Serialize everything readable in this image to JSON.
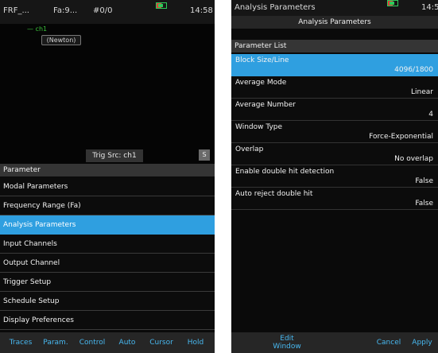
{
  "left": {
    "status": {
      "title": "FRF_...",
      "fa": "Fa:9...",
      "count": "#0/0",
      "time": "14:58"
    },
    "plot": {
      "legend": "ch1",
      "unit": "(Newton)",
      "trig_src": "Trig Src: ch1",
      "s_label": "S"
    },
    "panel_header": "Parameter",
    "menu": [
      "Modal Parameters",
      "Frequency Range (Fa)",
      "Analysis Parameters",
      "Input Channels",
      "Output Channel",
      "Trigger Setup",
      "Schedule Setup",
      "Display Preferences"
    ],
    "selected_index": 2,
    "softkeys": [
      "Traces",
      "Param.",
      "Control",
      "Auto",
      "Cursor",
      "Hold"
    ]
  },
  "right": {
    "status": {
      "title": "Analysis Parameters",
      "time": "14:5"
    },
    "dialog_title": "Analysis Parameters",
    "list_header": "Parameter List",
    "params": [
      {
        "label": "Block Size/Line",
        "value": "4096/1800"
      },
      {
        "label": "Average Mode",
        "value": "Linear"
      },
      {
        "label": "Average Number",
        "value": "4"
      },
      {
        "label": "Window Type",
        "value": "Force-Exponential"
      },
      {
        "label": "Overlap",
        "value": "No overlap"
      },
      {
        "label": "Enable double hit detection",
        "value": "False"
      },
      {
        "label": "Auto reject double hit",
        "value": "False"
      }
    ],
    "buttons": {
      "edit": "Edit",
      "edit_sub": "Window",
      "cancel": "Cancel",
      "apply": "Apply"
    }
  },
  "colors": {
    "accent": "#2f9fe0",
    "softkey": "#48b8f0",
    "battery": "#2ecc5a",
    "pin": "#e23a3a"
  }
}
